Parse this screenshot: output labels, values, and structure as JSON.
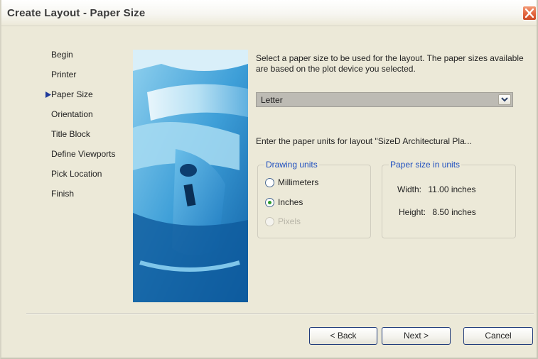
{
  "window": {
    "title": "Create Layout - Paper Size"
  },
  "steps": [
    {
      "label": "Begin",
      "active": false
    },
    {
      "label": "Printer",
      "active": false
    },
    {
      "label": "Paper Size",
      "active": true
    },
    {
      "label": "Orientation",
      "active": false
    },
    {
      "label": "Title Block",
      "active": false
    },
    {
      "label": "Define Viewports",
      "active": false
    },
    {
      "label": "Pick Location",
      "active": false
    },
    {
      "label": "Finish",
      "active": false
    }
  ],
  "main": {
    "description": "Select a paper size to be used for the layout.  The paper sizes available are based on the plot device you selected.",
    "paper_select": {
      "value": "Letter"
    },
    "units_prompt": "Enter the paper units for layout \"SizeD Architectural Pla..."
  },
  "drawing_units": {
    "legend": "Drawing units",
    "options": [
      {
        "label": "Millimeters",
        "checked": false,
        "disabled": false
      },
      {
        "label": "Inches",
        "checked": true,
        "disabled": false
      },
      {
        "label": "Pixels",
        "checked": false,
        "disabled": true
      }
    ]
  },
  "paper_size": {
    "legend": "Paper size in units",
    "width_label": "Width:",
    "width_value": "11.00 inches",
    "height_label": "Height:",
    "height_value": "8.50 inches"
  },
  "buttons": {
    "back": "< Back",
    "next": "Next >",
    "cancel": "Cancel"
  },
  "colors": {
    "accent": "#1f4fbf",
    "close": "#e0603a",
    "dialog_bg": "#ece9d8"
  }
}
